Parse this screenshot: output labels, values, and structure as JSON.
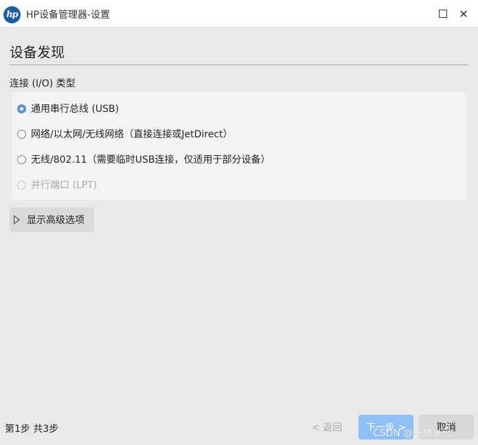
{
  "window": {
    "logo_text": "hp",
    "title": "HP设备管理器-设置",
    "maximize_symbol": "",
    "close_symbol": "✕"
  },
  "page": {
    "title": "设备发现"
  },
  "connection": {
    "label": "连接 (I/O) 类型",
    "options": [
      {
        "label": "通用串行总线 (USB)",
        "selected": true,
        "enabled": true
      },
      {
        "label": "网络/以太网/无线网络（直接连接或JetDirect）",
        "selected": false,
        "enabled": true
      },
      {
        "label": "无线/802.11（需要临时USB连接，仅适用于部分设备）",
        "selected": false,
        "enabled": true
      },
      {
        "label": "并行端口 (LPT)",
        "selected": false,
        "enabled": false
      }
    ]
  },
  "advanced": {
    "label": "显示高级选项",
    "icon": "triangle-right-icon"
  },
  "footer": {
    "step_text": "第1步 共3步",
    "back_label": "< 返回",
    "next_label": "下一步 >",
    "cancel_label": "取消",
    "watermark": "CSDN @一林米尺"
  },
  "colors": {
    "accent": "#5b95d8",
    "next_button": "#8ec0f7",
    "logo": "#1a5ea8",
    "background": "#e9e9e9"
  }
}
